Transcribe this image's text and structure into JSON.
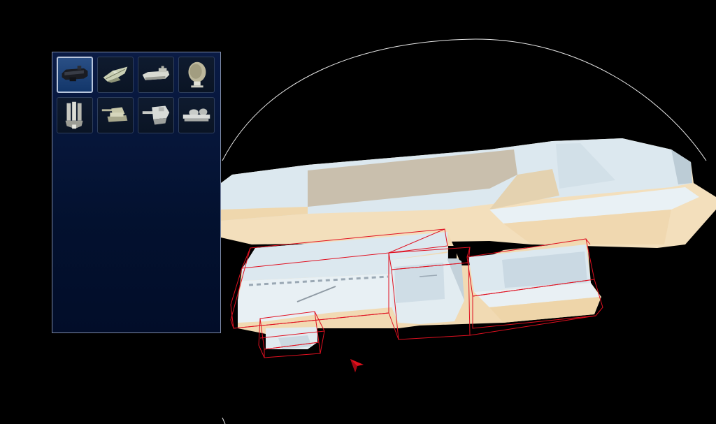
{
  "scene": {
    "background": "#000000",
    "hull_light": "#dce8ef",
    "hull_shadow": "#f3dfbc",
    "selection_color": "#e01020",
    "orbit_ring_color": "#e8e8e8"
  },
  "palette": {
    "panel_color": "#03112f",
    "parts": [
      {
        "icon": "dark-cannon-module-icon",
        "selected": true
      },
      {
        "icon": "wing-module-icon",
        "selected": false
      },
      {
        "icon": "engine-module-icon",
        "selected": false
      },
      {
        "icon": "radar-dish-icon",
        "selected": false
      },
      {
        "icon": "missile-launcher-icon",
        "selected": false
      },
      {
        "icon": "gun-turret-icon",
        "selected": false
      },
      {
        "icon": "heavy-turret-icon",
        "selected": false
      },
      {
        "icon": "dome-turret-icon",
        "selected": false
      }
    ]
  }
}
